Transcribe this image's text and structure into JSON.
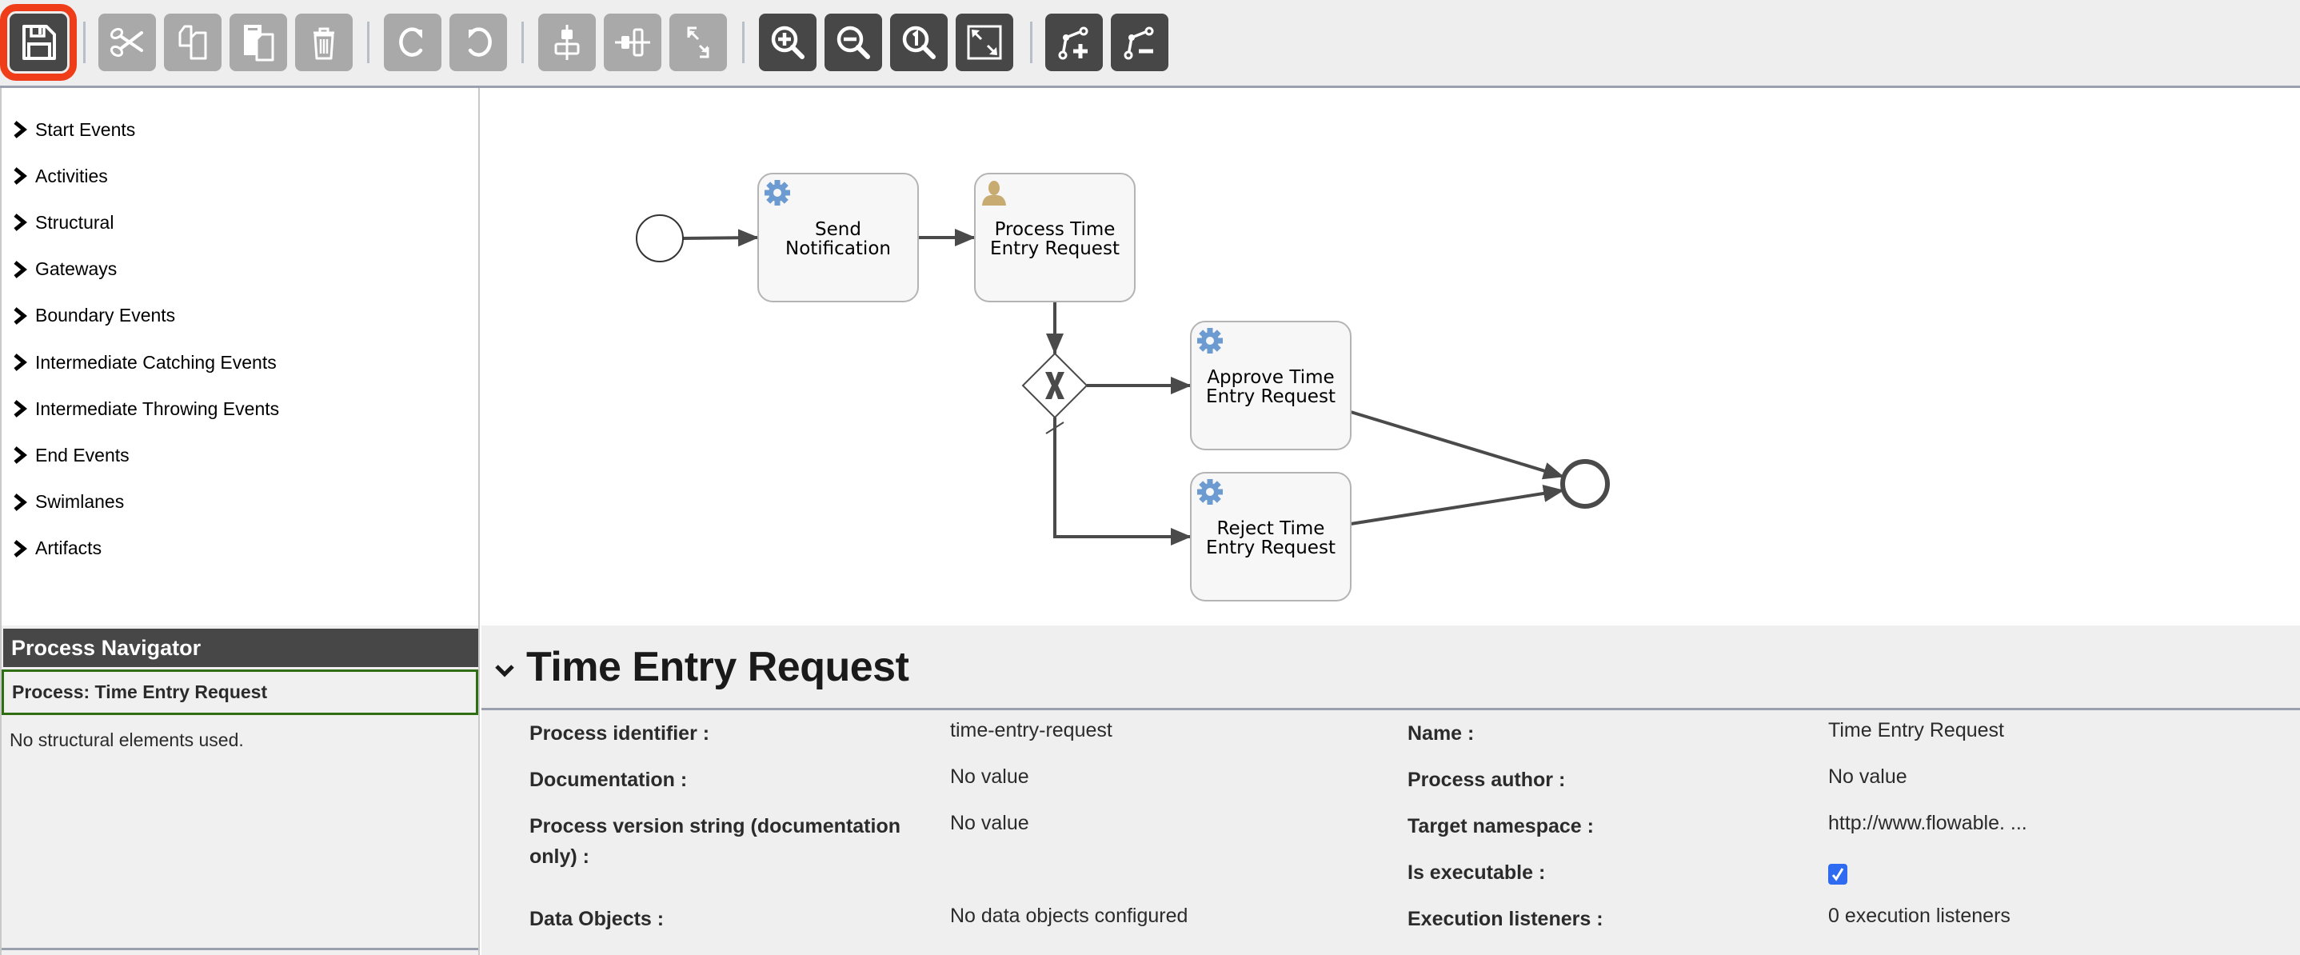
{
  "toolbar": {
    "buttons": [
      {
        "id": "save",
        "icon": "save-icon",
        "tooltip": "Save the model",
        "state": "active",
        "highlighted": true
      },
      {
        "id": "cut",
        "icon": "cut-icon",
        "state": "disabled"
      },
      {
        "id": "copy",
        "icon": "copy-icon",
        "state": "disabled"
      },
      {
        "id": "paste",
        "icon": "paste-icon",
        "state": "disabled"
      },
      {
        "id": "delete",
        "icon": "delete-icon",
        "state": "disabled"
      },
      {
        "id": "redo",
        "icon": "redo-icon",
        "state": "disabled"
      },
      {
        "id": "undo",
        "icon": "undo-icon",
        "state": "disabled"
      },
      {
        "id": "align-horizontal",
        "icon": "align-horizontal-icon",
        "state": "disabled"
      },
      {
        "id": "align-vertical",
        "icon": "align-vertical-icon",
        "state": "disabled"
      },
      {
        "id": "same-size",
        "icon": "same-size-icon",
        "state": "disabled"
      },
      {
        "id": "zoom-in",
        "icon": "zoom-in-icon",
        "state": "active"
      },
      {
        "id": "zoom-out",
        "icon": "zoom-out-icon",
        "state": "active"
      },
      {
        "id": "zoom-actual",
        "icon": "zoom-actual-icon",
        "state": "active"
      },
      {
        "id": "zoom-fit",
        "icon": "zoom-fit-icon",
        "state": "active"
      },
      {
        "id": "add-bendpoint",
        "icon": "add-bendpoint-icon",
        "state": "active"
      },
      {
        "id": "remove-bendpoint",
        "icon": "remove-bendpoint-icon",
        "state": "active"
      }
    ]
  },
  "palette": {
    "groups": [
      "Start Events",
      "Activities",
      "Structural",
      "Gateways",
      "Boundary Events",
      "Intermediate Catching Events",
      "Intermediate Throwing Events",
      "End Events",
      "Swimlanes",
      "Artifacts"
    ]
  },
  "navigator": {
    "title": "Process Navigator",
    "process": "Process: Time Entry Request",
    "empty_message": "No structural elements used."
  },
  "diagram": {
    "nodes": [
      {
        "id": "start",
        "type": "start-event"
      },
      {
        "id": "send-notification",
        "type": "service-task",
        "label_lines": [
          "Send",
          "Notification"
        ]
      },
      {
        "id": "process-time-entry",
        "type": "user-task",
        "label_lines": [
          "Process Time",
          "Entry Request"
        ]
      },
      {
        "id": "gateway",
        "type": "exclusive-gateway"
      },
      {
        "id": "approve",
        "type": "service-task",
        "label_lines": [
          "Approve Time",
          "Entry Request"
        ]
      },
      {
        "id": "reject",
        "type": "service-task",
        "label_lines": [
          "Reject Time",
          "Entry Request"
        ]
      },
      {
        "id": "end",
        "type": "end-event"
      }
    ],
    "flows": [
      {
        "from": "start",
        "to": "send-notification"
      },
      {
        "from": "send-notification",
        "to": "process-time-entry"
      },
      {
        "from": "process-time-entry",
        "to": "gateway"
      },
      {
        "from": "gateway",
        "to": "approve"
      },
      {
        "from": "gateway",
        "to": "reject",
        "default": true
      },
      {
        "from": "approve",
        "to": "end"
      },
      {
        "from": "reject",
        "to": "end"
      }
    ],
    "colors": {
      "service_icon": "#6c9bd1",
      "user_icon": "#c8ab70",
      "flow": "#4a4a4a",
      "task_fill": "#f7f7f7"
    }
  },
  "properties": {
    "title": "Time Entry Request",
    "left": [
      {
        "label": "Process identifier :",
        "value": "time-entry-request"
      },
      {
        "label": "Documentation :",
        "value": "No value"
      },
      {
        "label": "Process version string (documentation only) :",
        "value": "No value"
      },
      {
        "label": "Data Objects :",
        "value": "No data objects configured"
      }
    ],
    "right": [
      {
        "label": "Name :",
        "value": "Time Entry Request"
      },
      {
        "label": "Process author :",
        "value": "No value"
      },
      {
        "label": "Target namespace :",
        "value": "http://www.flowable. ..."
      },
      {
        "label": "Is executable :",
        "checked": true
      },
      {
        "label": "Execution listeners :",
        "value": "0 execution listeners"
      }
    ]
  }
}
